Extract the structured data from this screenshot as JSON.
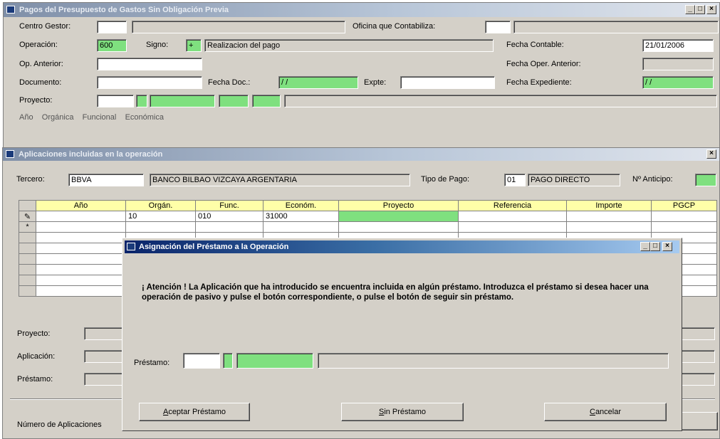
{
  "main_window": {
    "title": "Pagos del Presupuesto de Gastos Sin Obligación Previa",
    "labels": {
      "centro_gestor": "Centro Gestor:",
      "oficina": "Oficina que Contabiliza:",
      "operacion": "Operación:",
      "signo": "Signo:",
      "fecha_contable": "Fecha Contable:",
      "op_anterior": "Op. Anterior:",
      "fecha_oper_anterior": "Fecha Oper. Anterior:",
      "documento": "Documento:",
      "fecha_doc": "Fecha Doc.:",
      "expte": "Expte:",
      "fecha_expediente": "Fecha Expediente:",
      "proyecto": "Proyecto:",
      "partial_row": "Año    Orgánica    Funcional    Económica"
    },
    "values": {
      "operacion": "600",
      "signo": "+",
      "operacion_desc": "Realizacion del pago",
      "fecha_contable": "21/01/2006",
      "fecha_doc": "/ /",
      "fecha_expediente": "/ /"
    },
    "controls": [
      "_",
      "□",
      "×"
    ]
  },
  "aplicaciones_window": {
    "title": "Aplicaciones incluidas en la operación",
    "close": "×",
    "labels": {
      "tercero": "Tercero:",
      "tipo_pago": "Tipo de Pago:",
      "anticipo": "Nº Anticipo:",
      "proyecto": "Proyecto:",
      "aplicacion": "Aplicación:",
      "prestamo": "Préstamo:",
      "numero": "Número de Aplicaciones"
    },
    "values": {
      "tercero_code": "BBVA",
      "tercero_name": "BANCO BILBAO VIZCAYA ARGENTARIA",
      "tipo_pago_code": "01",
      "tipo_pago_desc": "PAGO DIRECTO"
    },
    "table": {
      "columns": [
        "Año",
        "Orgán.",
        "Func.",
        "Económ.",
        "Proyecto",
        "Referencia",
        "Importe",
        "PGCP"
      ],
      "rows": [
        {
          "marker": "✎",
          "cells": [
            "",
            "10",
            "010",
            "31000",
            "",
            "",
            "",
            ""
          ]
        },
        {
          "marker": "*",
          "cells": [
            "",
            "",
            "",
            "",
            "",
            "",
            "",
            ""
          ]
        },
        {
          "marker": "",
          "cells": [
            "",
            "",
            "",
            "",
            "",
            "",
            "",
            ""
          ]
        },
        {
          "marker": "",
          "cells": [
            "",
            "",
            "",
            "",
            "",
            "",
            "",
            ""
          ]
        },
        {
          "marker": "",
          "cells": [
            "",
            "",
            "",
            "",
            "",
            "",
            "",
            ""
          ]
        },
        {
          "marker": "",
          "cells": [
            "",
            "",
            "",
            "",
            "",
            "",
            "",
            ""
          ]
        },
        {
          "marker": "",
          "cells": [
            "",
            "",
            "",
            "",
            "",
            "",
            "",
            ""
          ]
        },
        {
          "marker": "",
          "cells": [
            "",
            "",
            "",
            "",
            "",
            "",
            "",
            ""
          ]
        }
      ]
    }
  },
  "dialog": {
    "title": "Asignación del Préstamo a la Operación",
    "message": "¡ Atención ! La Aplicación que ha introducido se encuentra incluida en algún préstamo. Introduzca el préstamo si desea hacer una operación de pasivo y pulse el botón correspondiente, o pulse el botón de seguir sin préstamo.",
    "prestamo_label": "Préstamo:",
    "buttons": {
      "aceptar_u": "A",
      "aceptar_rest": "ceptar Préstamo",
      "sin_u": "S",
      "sin_rest": "in Préstamo",
      "cancelar_u": "C",
      "cancelar_rest": "ancelar"
    },
    "controls": [
      "_",
      "□",
      "×"
    ]
  },
  "colors": {
    "required_field": "#7fe07f",
    "grid_header": "#ffffa8",
    "titlebar_active": "#0a246a"
  }
}
